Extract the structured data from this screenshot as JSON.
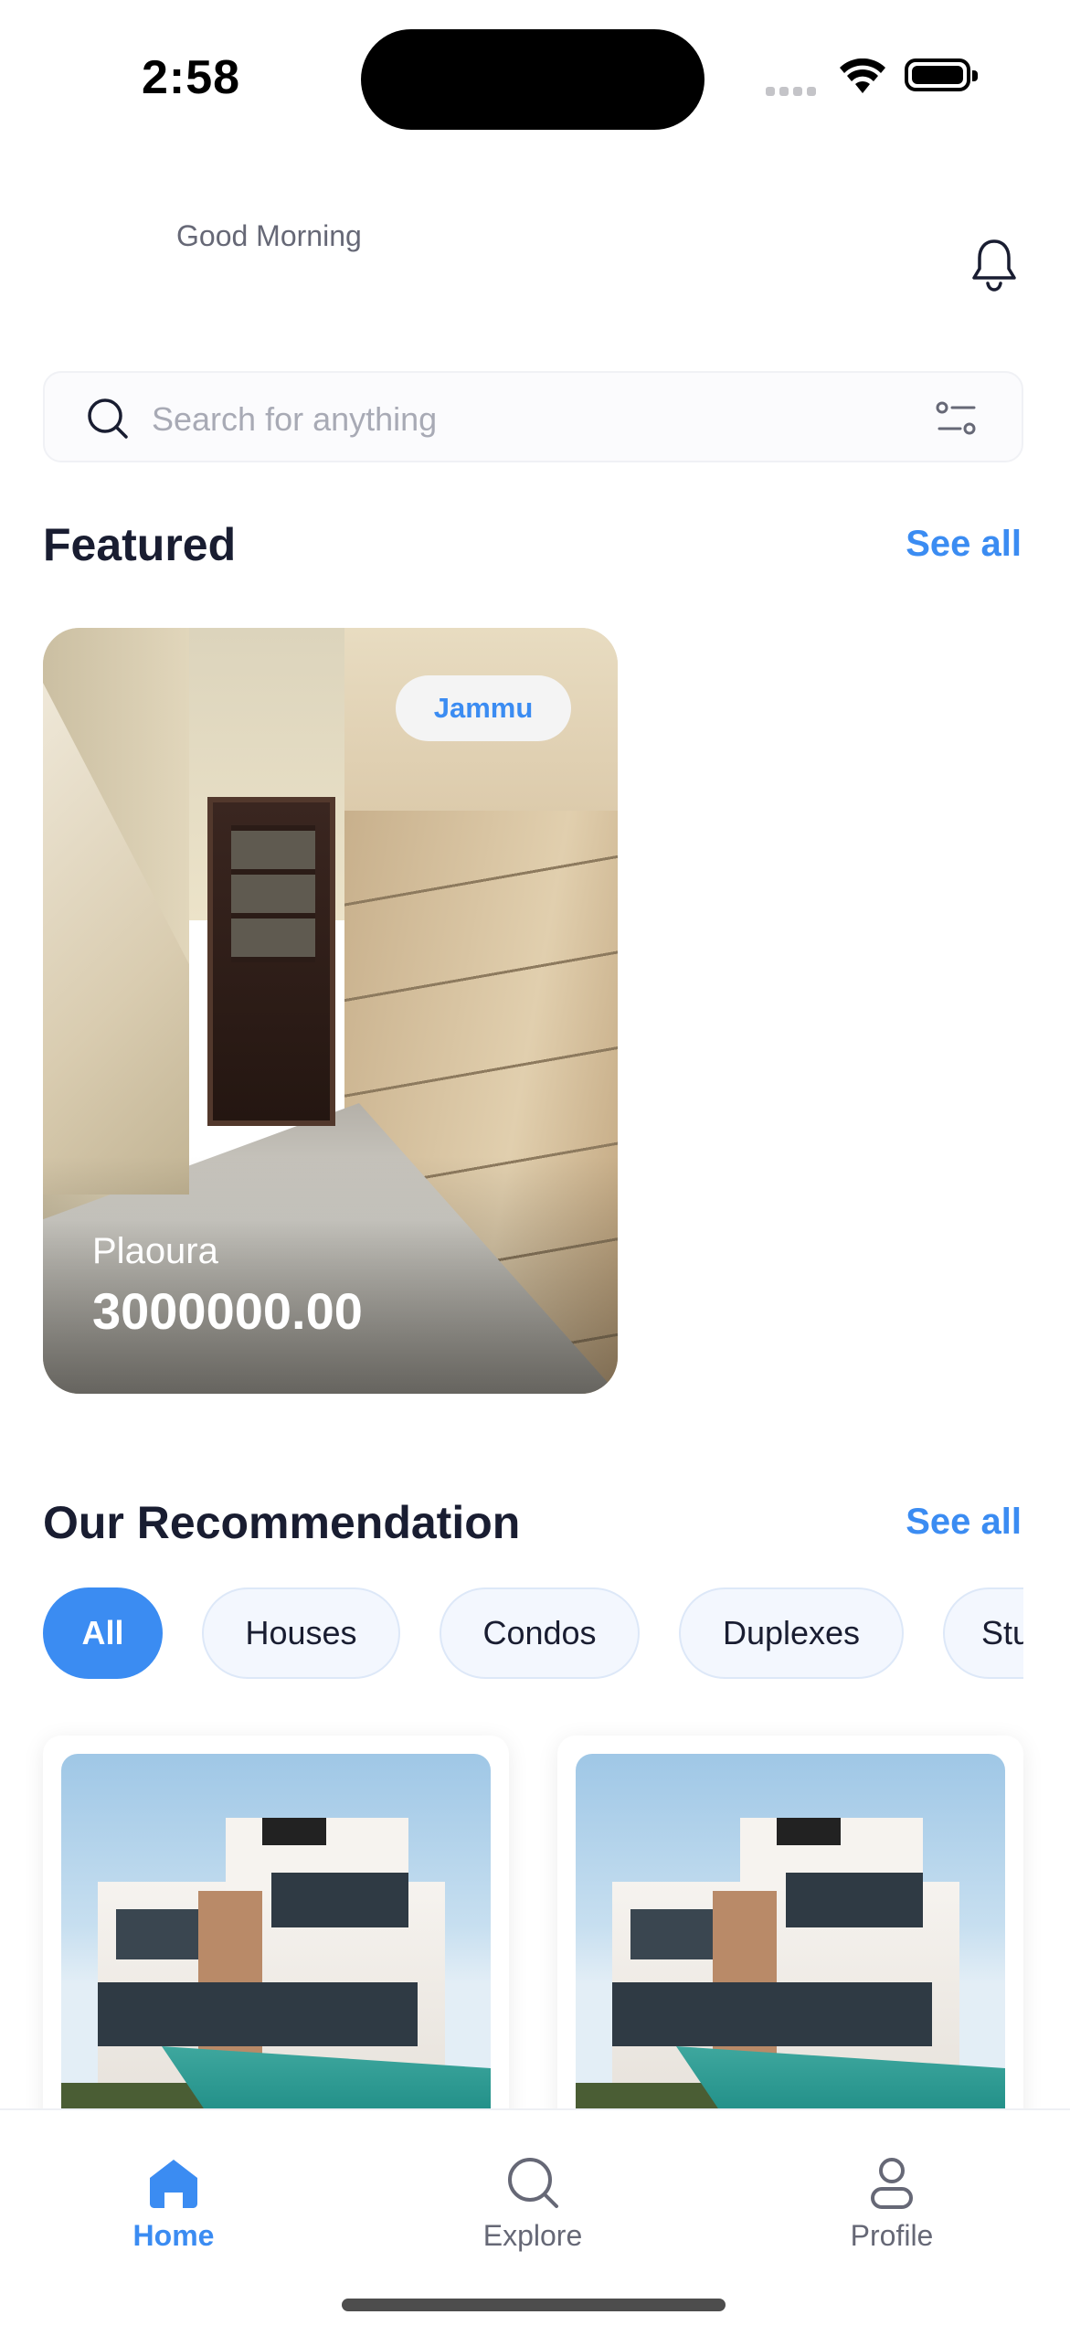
{
  "status_bar": {
    "time": "2:58"
  },
  "header": {
    "greeting": "Good Morning"
  },
  "search": {
    "placeholder": "Search for anything"
  },
  "featured": {
    "title": "Featured",
    "see_all": "See all",
    "cards": [
      {
        "badge": "Jammu",
        "name": "Plaoura",
        "price": "3000000.00"
      }
    ]
  },
  "recommendation": {
    "title": "Our Recommendation",
    "see_all": "See all",
    "filters": [
      "All",
      "Houses",
      "Condos",
      "Duplexes",
      "Studios"
    ],
    "active_filter": "All"
  },
  "tab_bar": {
    "home": "Home",
    "explore": "Explore",
    "profile": "Profile"
  },
  "colors": {
    "accent": "#3b8cf2",
    "text_dark": "#191d31",
    "text_muted": "#666876"
  }
}
